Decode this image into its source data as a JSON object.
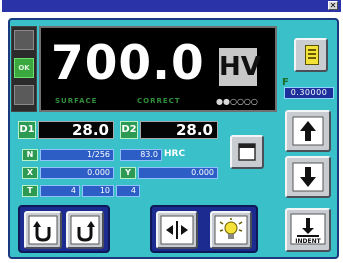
{
  "titlebar": {
    "close_glyph": "✕"
  },
  "status": {
    "ok_label": "OK"
  },
  "display": {
    "value": "700.0",
    "unit": "HV",
    "surface_label": "SURFACE",
    "correct_label": "CORRECT",
    "indicator": "●●○○○○"
  },
  "menu": {
    "icon": "menu-icon"
  },
  "readout": {
    "f_label": "F",
    "value": "0.30000"
  },
  "params": {
    "d1": {
      "label": "D1",
      "value": "28.0"
    },
    "d2": {
      "label": "D2",
      "value": "28.0"
    },
    "n": {
      "label": "N",
      "value": "1/256",
      "mid": "83.0",
      "hrc": "HRC"
    },
    "x": {
      "label": "X",
      "value": "0.000"
    },
    "y": {
      "label": "Y",
      "value": "0.000"
    },
    "t": {
      "label": "T",
      "a": "4",
      "b": "10",
      "c": "4"
    }
  },
  "buttons": {
    "indent_label": "INDENT",
    "up_icon": "arrow-up-icon",
    "down_icon": "arrow-down-icon",
    "rotate_ccw_icon": "rotate-ccw-icon",
    "rotate_cw_icon": "rotate-cw-icon",
    "width_icon": "width-adjust-icon",
    "lamp_icon": "lamp-icon",
    "stop_icon": "stop-icon"
  }
}
